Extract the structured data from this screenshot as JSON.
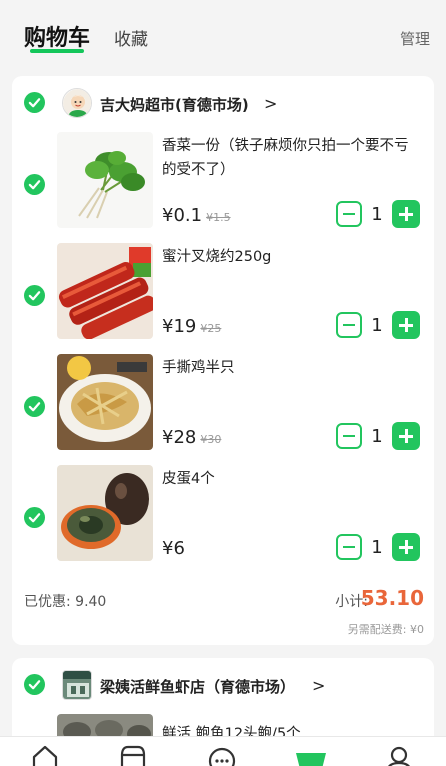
{
  "header": {
    "tab_cart": "购物车",
    "tab_favorites": "收藏",
    "manage": "管理"
  },
  "colors": {
    "accent": "#22c55e",
    "price_highlight": "#e9663a"
  },
  "stores": [
    {
      "name": "吉大妈超市(育德市场)",
      "chevron": ">",
      "items": [
        {
          "title": "香菜一份（铁子麻烦你只拍一个要不亏的受不了）",
          "price": "¥0.1",
          "old_price": "¥1.5",
          "qty": "1"
        },
        {
          "title": "蜜汁叉烧约250g",
          "price": "¥19",
          "old_price": "¥25",
          "qty": "1"
        },
        {
          "title": "手撕鸡半只",
          "price": "¥28",
          "old_price": "¥30",
          "qty": "1"
        },
        {
          "title": "皮蛋4个",
          "price": "¥6",
          "old_price": "",
          "qty": "1"
        }
      ],
      "discount": "已优惠: 9.40",
      "subtotal_label": "小计:",
      "subtotal_value": "53.10",
      "shipping": "另需配送费: ¥0"
    },
    {
      "name": "梁姨活鲜鱼虾店（育德市场）",
      "chevron": ">",
      "items": [
        {
          "title": "鲜活 鲍鱼12头鲍/5个"
        }
      ]
    }
  ],
  "tabbar": {
    "icons": [
      "home-icon",
      "store-icon",
      "message-icon",
      "cart-icon",
      "profile-icon"
    ],
    "active_index": 3
  }
}
